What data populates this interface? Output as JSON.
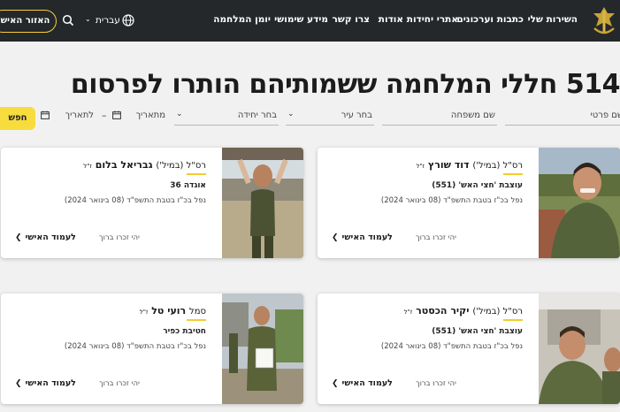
{
  "header": {
    "nav": [
      "השירות שלי",
      "כתבות וערכונים",
      "אתרי יחידות",
      "אודות",
      "צרו קשר",
      "מידע שימושי",
      "יומן המלחמה"
    ],
    "language": "עברית",
    "area_button": "האזור האישי"
  },
  "page": {
    "title": "514 חללי המלחמה ששמותיהם הותרו לפרסום"
  },
  "filters": {
    "first_name": "שם פרטי",
    "last_name": "שם משפחה",
    "city": "בחר עיר",
    "unit": "בחר יחידה",
    "from_date": "מתאריך",
    "dash": "–",
    "to_date": "לתאריך",
    "search": "חפש"
  },
  "cards": [
    {
      "rank": "רס\"ל (במיל')",
      "name": "דוד שורץ",
      "suffix": "ז\"ל",
      "unit": "עוצבת 'חצי האש' (551)",
      "fell": "נפל בכ\"ז בטבת התשפ\"ד (08 בינואר 2024)",
      "rip": "יהי זכרו ברוך",
      "link": "לעמוד האישי"
    },
    {
      "rank": "רס\"ל (במיל')",
      "name": "גבריאל בלום",
      "suffix": "ז\"ל",
      "unit": "אוגדה 36",
      "fell": "נפל בכ\"ז בטבת התשפ\"ד (08 בינואר 2024)",
      "rip": "יהי זכרו ברוך",
      "link": "לעמוד האישי"
    },
    {
      "rank": "רס\"ל (במיל')",
      "name": "יקיר הכסטר",
      "suffix": "ז\"ל",
      "unit": "עוצבת 'חצי האש' (551)",
      "fell": "נפל בכ\"ז בטבת התשפ\"ד (08 בינואר 2024)",
      "rip": "יהי זכרו ברוך",
      "link": "לעמוד האישי"
    },
    {
      "rank": "סמל",
      "name": "רועי טל",
      "suffix": "ז\"ל",
      "unit": "חטיבת כפיר",
      "fell": "נפל בכ\"ז בטבת התשפ\"ד (08 בינואר 2024)",
      "rip": "יהי זכרו ברוך",
      "link": "לעמוד האישי"
    }
  ],
  "colors": {
    "header_bg": "#25282b",
    "accent_yellow": "#f7dc3e",
    "page_bg": "#f1f1f1"
  }
}
